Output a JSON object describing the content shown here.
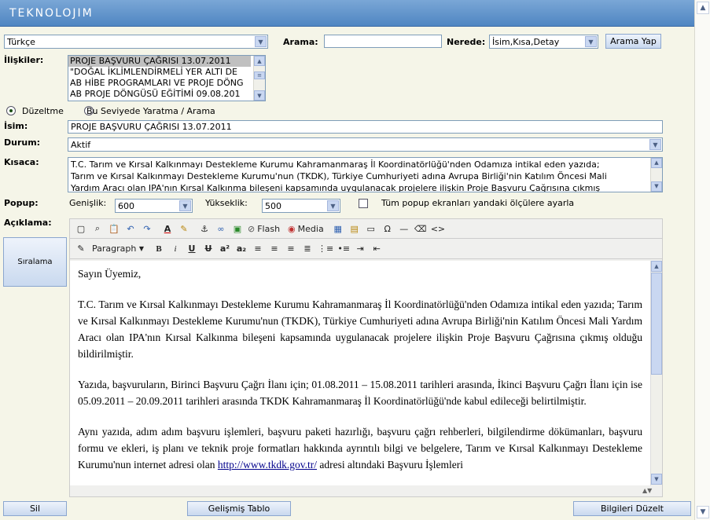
{
  "app": {
    "logo": "TEKNOLOJIM"
  },
  "top": {
    "language_value": "Türkçe",
    "search_label": "Arama:",
    "search_value": "",
    "where_label": "Nerede:",
    "where_value": "İsim,Kısa,Detay",
    "search_button": "Arama Yap"
  },
  "relations": {
    "label": "İlişkiler:",
    "items": [
      "PROJE BAŞVURU ÇAĞRISI 13.07.2011",
      "\"DOĞAL İKLİMLENDİRMELİ YER ALTI DE",
      "AB HİBE PROGRAMLARI VE PROJE DÖNG",
      "AB PROJE DÖNGÜSÜ EĞİTİMİ 09.08.201"
    ]
  },
  "mode": {
    "edit_label": "Düzeltme",
    "create_label": "Bu Seviyede Yaratma / Arama"
  },
  "form": {
    "name_label": "İsim:",
    "name_value": "PROJE BAŞVURU ÇAĞRISI 13.07.2011",
    "status_label": "Durum:",
    "status_value": "Aktif",
    "short_label": "Kısaca:",
    "short_lines": [
      "T.C. Tarım ve Kırsal Kalkınmayı Destekleme Kurumu Kahramanmaraş İl Koordinatörlüğü'nden Odamıza intikal eden yazıda;",
      "Tarım ve Kırsal Kalkınmayı Destekleme Kurumu'nun (TKDK), Türkiye Cumhuriyeti adına Avrupa Birliği'nin Katılım Öncesi Mali",
      "Yardım Aracı olan IPA'nın Kırsal Kalkınma bileşeni kapsamında uygulanacak projelere ilişkin Proje Başvuru Çağrısına çıkmış"
    ],
    "popup_label": "Popup:",
    "width_label": "Genişlik:",
    "width_value": "600",
    "height_label": "Yükseklik:",
    "height_value": "500",
    "all_popup_label": "Tüm popup ekranları yandaki ölçülere ayarla",
    "desc_label": "Açıklama:"
  },
  "editor": {
    "flash_label": "Flash",
    "media_label": "Media",
    "format_value": "Paragraph",
    "paragraphs": [
      "Sayın Üyemiz,",
      "T.C. Tarım ve Kırsal Kalkınmayı Destekleme Kurumu Kahramanmaraş İl Koordinatörlüğü'nden Odamıza intikal eden yazıda; Tarım ve Kırsal Kalkınmayı Destekleme Kurumu'nun (TKDK), Türkiye Cumhuriyeti adına Avrupa Birliği'nin Katılım Öncesi Mali Yardım Aracı olan IPA'nın Kırsal Kalkınma bileşeni kapsamında uygulanacak projelere ilişkin Proje Başvuru Çağrısına çıkmış olduğu bildirilmiştir.",
      "Yazıda, başvuruların, Birinci Başvuru Çağrı İlanı için; 01.08.2011 – 15.08.2011 tarihleri arasında, İkinci Başvuru Çağrı İlanı için ise 05.09.2011 – 20.09.2011 tarihleri arasında TKDK Kahramanmaraş İl Koordinatörlüğü'nde kabul edileceği belirtilmiştir."
    ],
    "p4_before": "Aynı yazıda, adım adım başvuru işlemleri, başvuru paketi hazırlığı, başvuru çağrı rehberleri, bilgilendirme dökümanları, başvuru formu ve ekleri, iş planı ve teknik proje formatları hakkında ayrıntılı bilgi ve belgelere, Tarım ve Kırsal Kalkınmayı Destekleme Kurumu'nun internet adresi olan ",
    "p4_link": "http://www.tkdk.gov.tr/",
    "p4_after": " adresi altındaki Başvuru İşlemleri"
  },
  "side": {
    "sort_button": "Sıralama"
  },
  "bottom": {
    "delete_button": "Sil",
    "advanced_table_button": "Gelişmiş Tablo",
    "save_button": "Bilgileri Düzelt"
  },
  "colors": {
    "header": "#4f86c2",
    "background": "#f5f5e8",
    "link": "#00008b"
  }
}
